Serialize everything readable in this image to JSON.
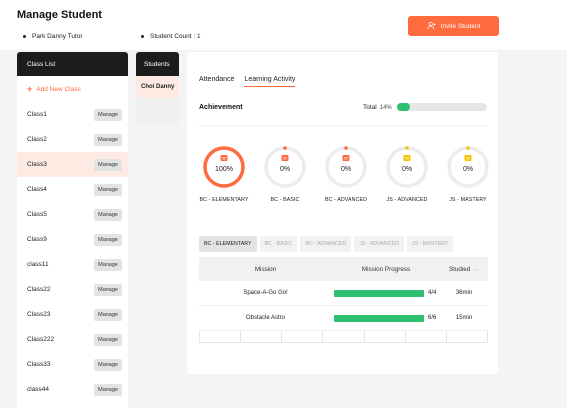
{
  "page": {
    "title": "Manage Student"
  },
  "info": {
    "tutor": "Park Danny Tutor",
    "student_count": "Student Count : 1"
  },
  "invite": {
    "label": "Invite Student"
  },
  "class_list": {
    "header": "Class List",
    "add_label": "Add New Class",
    "manage_label": "Manage",
    "items": [
      "Class1",
      "Class2",
      "Class3",
      "Class4",
      "Class5",
      "Class9",
      "class11",
      "Class22",
      "Class23",
      "Class222",
      "Class33",
      "class44"
    ],
    "active": "Class3"
  },
  "students": {
    "header": "Students",
    "items": [
      "Choi Danny"
    ]
  },
  "panel": {
    "tabs": [
      "Attendance",
      "Learning Activity"
    ],
    "active_tab": "Learning Activity",
    "achievement_label": "Achievement",
    "total_label": "Total",
    "total_pct": "14%",
    "total_value": 0.14,
    "circles": [
      {
        "label": "BC - ELEMENTARY",
        "value": "100%",
        "fraction": 1.0,
        "icon": "book-icon",
        "color": "#ff6b3d"
      },
      {
        "label": "BC - BASIC",
        "value": "0%",
        "fraction": 0,
        "icon": "book-icon",
        "color": "#ff6b3d"
      },
      {
        "label": "BC - ADVANCED",
        "value": "0%",
        "fraction": 0,
        "icon": "book-icon",
        "color": "#ff6b3d"
      },
      {
        "label": "JS - ADVANCED",
        "value": "0%",
        "fraction": 0,
        "icon": "book-icon",
        "color": "#f5c400"
      },
      {
        "label": "JS - MASTERY",
        "value": "0%",
        "fraction": 0,
        "icon": "book-icon",
        "color": "#f5c400"
      }
    ],
    "subtabs": [
      "BC - ELEMENTARY",
      "BC - BASIC",
      "BC - ADVANCED",
      "JS - ADVANCED",
      "JS - MASTERY"
    ],
    "active_subtab": "BC - ELEMENTARY",
    "table": {
      "headers": {
        "mission": "Mission",
        "progress": "Mission Progress",
        "studied": "Studied"
      },
      "rows": [
        {
          "mission": "Space-A-Go Go!",
          "progress": "4/4",
          "fraction": 1.0,
          "studied": "36min"
        },
        {
          "mission": "Obstacle Astro",
          "progress": "6/6",
          "fraction": 1.0,
          "studied": "15min"
        }
      ]
    }
  },
  "colors": {
    "accent": "#ff6b3d",
    "success": "#2fbf71",
    "dark": "#1c1c1c",
    "active_row": "#fdebe3"
  }
}
